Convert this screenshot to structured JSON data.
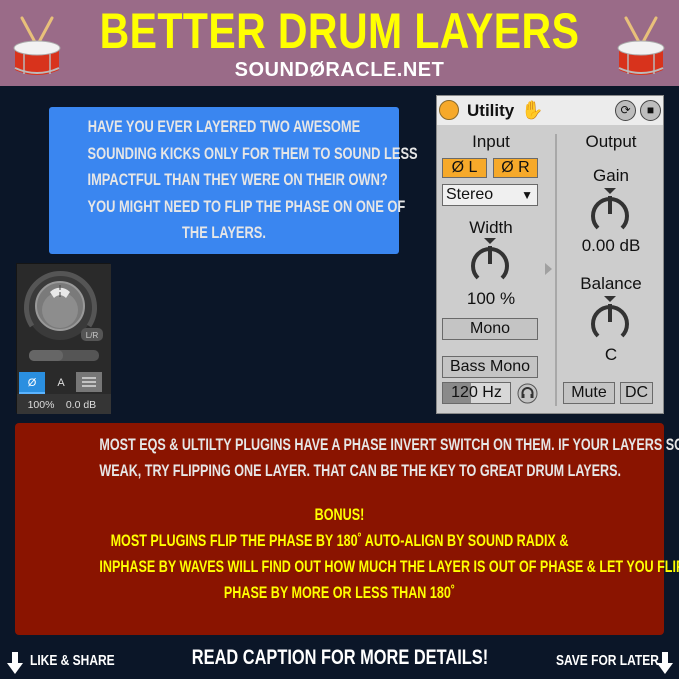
{
  "header": {
    "title": "BETTER DRUM LAYERS",
    "subtitle": "SOUNDØRACLE.NET",
    "left_icon": "drum-icon",
    "right_icon": "drum-icon",
    "background": "#9a6b88",
    "title_color": "#ffff00"
  },
  "question_box": {
    "lines": [
      "HAVE YOU EVER LAYERED TWO AWESOME",
      "SOUNDING KICKS ONLY FOR THEM TO SOUND LESS",
      "IMPACTFUL THAN THEY WERE ON THEIR OWN?",
      "YOU MIGHT NEED TO FLIP THE PHASE ON ONE OF",
      "THE LAYERS."
    ],
    "background": "#3a86f0"
  },
  "utility_plugin": {
    "title": "Utility",
    "icons": [
      "power-dot-icon",
      "hand-icon",
      "swap-icon",
      "save-icon"
    ],
    "input": {
      "label": "Input",
      "phase_left": "Ø L",
      "phase_right": "Ø R",
      "channel_mode": "Stereo",
      "width_label": "Width",
      "width_value": "100 %",
      "mono_label": "Mono",
      "bass_mono_label": "Bass Mono",
      "bass_mono_freq": "120 Hz"
    },
    "output": {
      "label": "Output",
      "gain_label": "Gain",
      "gain_value": "0.00 dB",
      "balance_label": "Balance",
      "balance_value": "C",
      "mute_label": "Mute",
      "dc_label": "DC"
    }
  },
  "channel_strip": {
    "pan_badge": "L/R",
    "phase_button": "Ø",
    "auto_button": "A",
    "menu_icon": "menu-icon",
    "width_value": "100%",
    "gain_value": "0.0 dB"
  },
  "info_box": {
    "lines": [
      "MOST EQS & ULTILTY PLUGINS HAVE A PHASE INVERT SWITCH ON THEM. IF YOUR LAYERS SOUND",
      "WEAK, TRY FLIPPING ONE LAYER. THAT CAN BE THE KEY TO GREAT DRUM LAYERS."
    ],
    "bonus_title": "BONUS!",
    "bonus_lines": [
      "MOST PLUGINS FLIP THE PHASE BY 180˚ AUTO-ALIGN BY SOUND RADIX  &",
      "INPHASE BY WAVES WILL FIND OUT HOW MUCH THE LAYER IS OUT OF PHASE & LET YOU FLIP THE",
      "PHASE BY MORE OR LESS THAN 180˚"
    ],
    "background": "#8a1400"
  },
  "footer": {
    "like_share": "LIKE & SHARE",
    "caption": "READ CAPTION FOR MORE DETAILS!",
    "save_later": "SAVE FOR LATER"
  }
}
